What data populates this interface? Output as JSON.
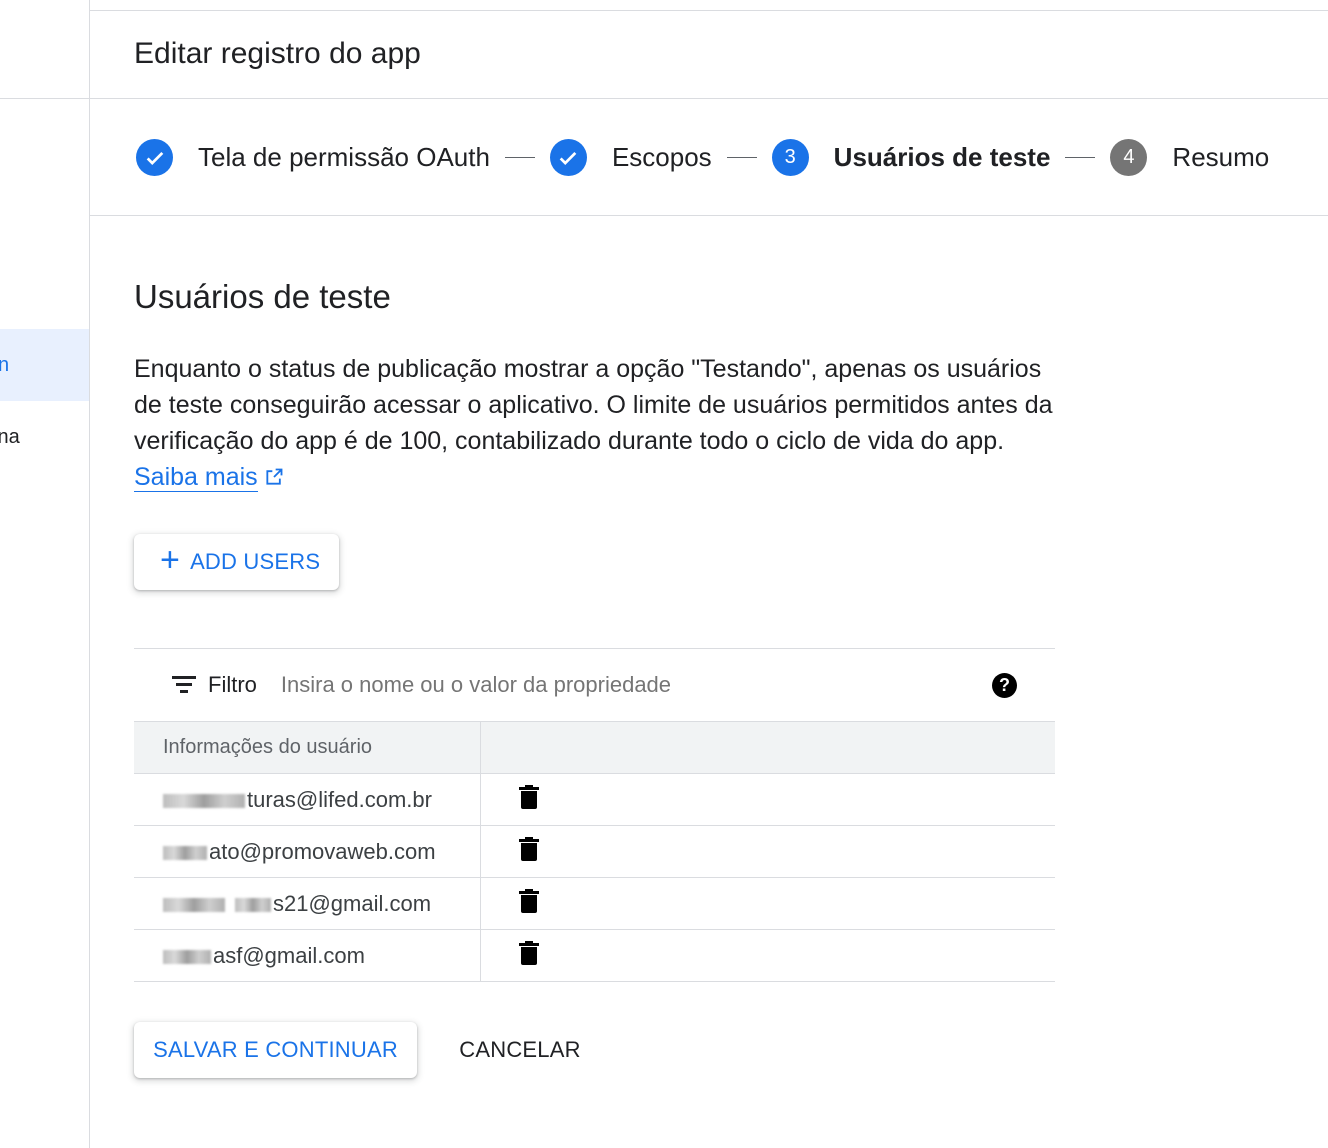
{
  "leftnav": {
    "items": [
      {
        "label": "n"
      },
      {
        "label": "ina"
      }
    ]
  },
  "header": {
    "title": "Editar registro do app"
  },
  "stepper": {
    "steps": [
      {
        "label": "Tela de permissão OAuth",
        "state": "done"
      },
      {
        "label": "Escopos",
        "state": "done"
      },
      {
        "number": "3",
        "label": "Usuários de teste",
        "state": "current"
      },
      {
        "number": "4",
        "label": "Resumo",
        "state": "future"
      }
    ]
  },
  "section": {
    "title": "Usuários de teste",
    "description": "Enquanto o status de publicação mostrar a opção \"Testando\", apenas os usuários de teste conseguirão acessar o aplicativo. O limite de usuários permitidos antes da verificação do app é de 100, contabilizado durante todo o ciclo de vida do app. ",
    "learn_more": "Saiba mais"
  },
  "add_users": {
    "label": "ADD USERS"
  },
  "filter": {
    "label": "Filtro",
    "placeholder": "Insira o nome ou o valor da propriedade"
  },
  "table": {
    "header": "Informações do usuário",
    "rows": [
      {
        "email": "turas@lifed.com.br"
      },
      {
        "email": "ato@promovaweb.com"
      },
      {
        "email": "s21@gmail.com"
      },
      {
        "email": "asf@gmail.com"
      }
    ]
  },
  "actions": {
    "save": "SALVAR E CONTINUAR",
    "cancel": "CANCELAR"
  },
  "colors": {
    "accent": "#1a73e8",
    "active_nav_bg": "#e8f0fe",
    "step_future": "#757575"
  },
  "icons": [
    "check-icon",
    "plus-icon",
    "filter-icon",
    "help-icon",
    "trash-icon",
    "external-link-icon"
  ]
}
